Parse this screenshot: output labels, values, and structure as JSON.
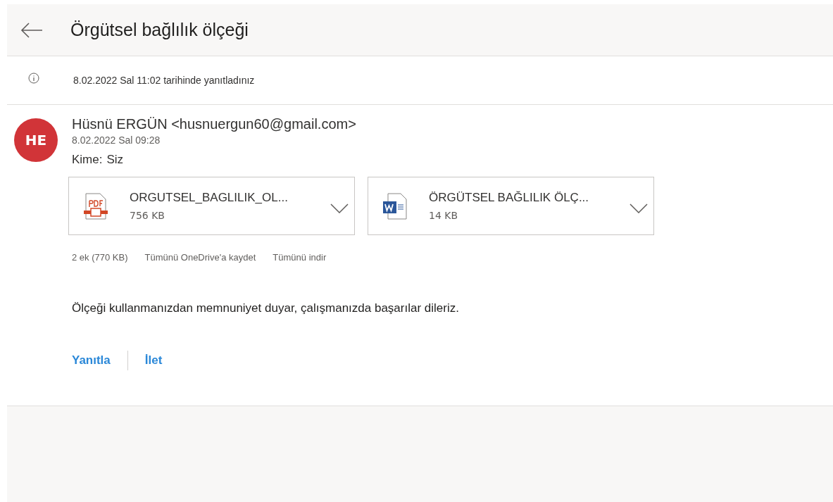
{
  "header": {
    "title": "Örgütsel bağlılık ölçeği"
  },
  "info_bar": {
    "text": "8.02.2022 Sal 11:02 tarihinde yanıtladınız"
  },
  "message": {
    "avatar_initials": "HE",
    "sender": "Hüsnü ERGÜN <husnuergun60@gmail.com>",
    "date": "8.02.2022 Sal 09:28",
    "to_label": "Kime:",
    "to_value": "Siz",
    "attachments": [
      {
        "kind": "pdf",
        "name": "ORGUTSEL_BAGLILIK_OL...",
        "size": "756 KB"
      },
      {
        "kind": "word",
        "name": "ÖRGÜTSEL BAĞLILIK ÖLÇ...",
        "size": "14 KB"
      }
    ],
    "attachment_summary": "2 ek (770 KB)",
    "attachment_actions": [
      "Tümünü OneDrive'a kaydet",
      "Tümünü indir"
    ],
    "body": "Ölçeği kullanmanızdan memnuniyet duyar, çalışmanızda başarılar dileriz.",
    "actions": [
      "Yanıtla",
      "İlet"
    ]
  }
}
